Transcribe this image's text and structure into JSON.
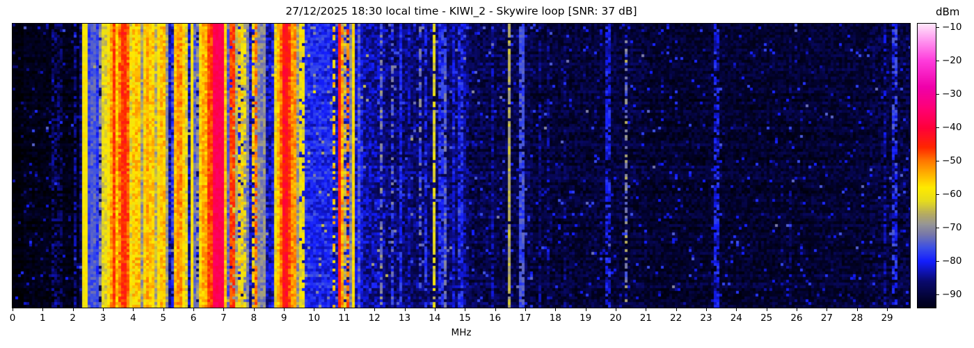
{
  "title": "27/12/2025 18:30 local time - KIWI_2 - Skywire loop [SNR: 37 dB]",
  "x_axis": {
    "unit_label": "MHz",
    "tick_labels": [
      "0",
      "1",
      "2",
      "3",
      "4",
      "5",
      "6",
      "7",
      "8",
      "9",
      "10",
      "11",
      "12",
      "13",
      "14",
      "15",
      "16",
      "17",
      "18",
      "19",
      "20",
      "21",
      "22",
      "23",
      "24",
      "25",
      "26",
      "27",
      "28",
      "29"
    ],
    "tick_values": [
      0,
      1,
      2,
      3,
      4,
      5,
      6,
      7,
      8,
      9,
      10,
      11,
      12,
      13,
      14,
      15,
      16,
      17,
      18,
      19,
      20,
      21,
      22,
      23,
      24,
      25,
      26,
      27,
      28,
      29
    ]
  },
  "colorbar": {
    "unit_label": "dBm",
    "tick_labels": [
      "−10",
      "−20",
      "−30",
      "−40",
      "−50",
      "−60",
      "−70",
      "−80",
      "−90"
    ],
    "tick_values": [
      -10,
      -20,
      -30,
      -40,
      -50,
      -60,
      -70,
      -80,
      -90
    ],
    "vmax": -9,
    "vmin": -94
  },
  "chart_data": {
    "type": "heatmap",
    "title": "27/12/2025 18:30 local time - KIWI_2 - Skywire loop [SNR: 37 dB]",
    "xlabel": "MHz",
    "colorbar_label": "dBm",
    "x_range_mhz": [
      0,
      29.76
    ],
    "value_range_dbm": [
      -94,
      -9
    ],
    "legend_position": "right-colorbar",
    "grid": false,
    "palette_stops_dbm_rgb": [
      [
        -97,
        0,
        0,
        0
      ],
      [
        -92,
        2,
        2,
        40
      ],
      [
        -86,
        10,
        10,
        110
      ],
      [
        -80,
        20,
        30,
        255
      ],
      [
        -76,
        60,
        80,
        230
      ],
      [
        -72,
        120,
        120,
        170
      ],
      [
        -69,
        150,
        150,
        150
      ],
      [
        -66,
        180,
        170,
        100
      ],
      [
        -62,
        230,
        220,
        30
      ],
      [
        -58,
        255,
        235,
        0
      ],
      [
        -54,
        255,
        180,
        0
      ],
      [
        -50,
        255,
        120,
        0
      ],
      [
        -46,
        255,
        40,
        0
      ],
      [
        -40,
        255,
        0,
        60
      ],
      [
        -34,
        255,
        0,
        120
      ],
      [
        -28,
        240,
        0,
        170
      ],
      [
        -20,
        255,
        60,
        220
      ],
      [
        -14,
        255,
        150,
        240
      ],
      [
        -9,
        255,
        230,
        250
      ]
    ],
    "noise_floor_fields": [
      "f_from_mhz",
      "f_to_mhz",
      "level_dbm",
      "variance_db"
    ],
    "noise_floor_regions": [
      [
        0,
        0.35,
        -95.5,
        1.5
      ],
      [
        0.35,
        2.25,
        -94,
        2.5
      ],
      [
        2.25,
        3.0,
        -87,
        4
      ],
      [
        3.0,
        5.2,
        -80,
        5
      ],
      [
        5.2,
        6.7,
        -84,
        4
      ],
      [
        6.7,
        7.6,
        -82,
        4
      ],
      [
        7.6,
        8.6,
        -83,
        4
      ],
      [
        8.6,
        9.65,
        -81,
        4
      ],
      [
        9.65,
        10.6,
        -79.5,
        3.5
      ],
      [
        10.6,
        11.65,
        -82,
        4
      ],
      [
        11.65,
        12.4,
        -84,
        4
      ],
      [
        12.4,
        15.1,
        -86.5,
        4
      ],
      [
        15.1,
        17.3,
        -89,
        4
      ],
      [
        17.3,
        21,
        -90.5,
        3.5
      ],
      [
        21,
        26.5,
        -91.5,
        3
      ],
      [
        26.5,
        28.4,
        -91,
        3
      ],
      [
        28.4,
        29.8,
        -90,
        4
      ]
    ],
    "stripe_fields": [
      "freq_mhz",
      "halfwidth_mhz",
      "level_dbm",
      "variance_db",
      "dash_gap_fraction"
    ],
    "signal_stripes": [
      [
        1.4,
        0.02,
        -86,
        3,
        0.5
      ],
      [
        1.55,
        0.02,
        -87,
        3,
        0.5
      ],
      [
        2.1,
        0.02,
        -85,
        3,
        0.4
      ],
      [
        2.42,
        0.025,
        -59,
        2.5,
        0
      ],
      [
        2.56,
        0.03,
        -77,
        3,
        0
      ],
      [
        2.68,
        0.025,
        -75,
        3,
        0
      ],
      [
        2.8,
        0.02,
        -78,
        3,
        0
      ],
      [
        2.93,
        0.02,
        -71,
        4,
        0.2
      ],
      [
        3.03,
        0.03,
        -62,
        4,
        0
      ],
      [
        3.12,
        0.02,
        -72,
        4,
        0
      ],
      [
        3.2,
        0.03,
        -58,
        4,
        0
      ],
      [
        3.28,
        0.03,
        -53,
        4,
        0
      ],
      [
        3.36,
        0.035,
        -47,
        3,
        0
      ],
      [
        3.44,
        0.02,
        -55,
        4,
        0
      ],
      [
        3.52,
        0.02,
        -63,
        5,
        0
      ],
      [
        3.6,
        0.03,
        -50,
        4,
        0
      ],
      [
        3.68,
        0.035,
        -46,
        3,
        0
      ],
      [
        3.76,
        0.03,
        -49,
        4,
        0
      ],
      [
        3.84,
        0.025,
        -56,
        4,
        0
      ],
      [
        3.92,
        0.02,
        -61,
        5,
        0
      ],
      [
        4.0,
        0.03,
        -57,
        5,
        0
      ],
      [
        4.08,
        0.025,
        -63,
        5,
        0
      ],
      [
        4.16,
        0.03,
        -56,
        5,
        0
      ],
      [
        4.24,
        0.02,
        -68,
        5,
        0
      ],
      [
        4.32,
        0.03,
        -74,
        4,
        0
      ],
      [
        4.4,
        0.03,
        -57,
        4,
        0
      ],
      [
        4.48,
        0.035,
        -54,
        4,
        0
      ],
      [
        4.56,
        0.025,
        -59,
        4,
        0
      ],
      [
        4.64,
        0.03,
        -56,
        4,
        0
      ],
      [
        4.72,
        0.02,
        -66,
        5,
        0
      ],
      [
        4.8,
        0.02,
        -73,
        4,
        0
      ],
      [
        4.88,
        0.03,
        -58,
        4,
        0
      ],
      [
        4.96,
        0.03,
        -55,
        4,
        0
      ],
      [
        5.06,
        0.025,
        -68,
        5,
        0
      ],
      [
        5.14,
        0.02,
        -74,
        4,
        0
      ],
      [
        5.28,
        0.02,
        -77,
        4,
        0.3
      ],
      [
        5.45,
        0.03,
        -55,
        4,
        0
      ],
      [
        5.53,
        0.03,
        -52,
        4,
        0
      ],
      [
        5.62,
        0.025,
        -57,
        4,
        0
      ],
      [
        5.7,
        0.02,
        -70,
        5,
        0
      ],
      [
        5.78,
        0.02,
        -62,
        5,
        0
      ],
      [
        5.95,
        0.02,
        -59,
        3,
        0
      ],
      [
        6.07,
        0.02,
        -74,
        4,
        0
      ],
      [
        6.17,
        0.02,
        -70,
        5,
        0.2
      ],
      [
        6.3,
        0.03,
        -57,
        4,
        0
      ],
      [
        6.38,
        0.025,
        -54,
        4,
        0
      ],
      [
        6.46,
        0.02,
        -61,
        5,
        0
      ],
      [
        6.56,
        0.015,
        -47,
        3,
        0
      ],
      [
        6.63,
        0.02,
        -57,
        4,
        0
      ],
      [
        6.85,
        0.16,
        -37.5,
        1.8,
        0
      ],
      [
        7.04,
        0.02,
        -55,
        3,
        0
      ],
      [
        7.13,
        0.02,
        -74,
        4,
        0
      ],
      [
        7.3,
        0.012,
        -47,
        3,
        0.1
      ],
      [
        7.4,
        0.02,
        -67,
        5,
        0
      ],
      [
        7.56,
        0.02,
        -59,
        6,
        0.3
      ],
      [
        7.66,
        0.02,
        -63,
        6,
        0.2
      ],
      [
        7.76,
        0.02,
        -72,
        5,
        0
      ],
      [
        7.97,
        0.02,
        -57,
        6,
        0.3
      ],
      [
        8.06,
        0.012,
        -50,
        4,
        0.2
      ],
      [
        8.14,
        0.02,
        -70,
        4,
        0
      ],
      [
        8.27,
        0.015,
        -71,
        4,
        0
      ],
      [
        8.37,
        0.015,
        -70,
        4,
        0
      ],
      [
        8.72,
        0.025,
        -60,
        5,
        0
      ],
      [
        8.8,
        0.03,
        -55,
        4,
        0
      ],
      [
        8.88,
        0.025,
        -57,
        4,
        0
      ],
      [
        8.96,
        0.03,
        -50,
        4,
        0
      ],
      [
        9.04,
        0.035,
        -43,
        3,
        0
      ],
      [
        9.12,
        0.03,
        -47,
        4,
        0
      ],
      [
        9.2,
        0.025,
        -54,
        4,
        0
      ],
      [
        9.3,
        0.025,
        -52,
        4,
        0
      ],
      [
        9.38,
        0.02,
        -57,
        5,
        0
      ],
      [
        9.46,
        0.02,
        -68,
        5,
        0
      ],
      [
        9.6,
        0.015,
        -60,
        4,
        0.2
      ],
      [
        10.67,
        0.02,
        -57,
        5,
        0.45
      ],
      [
        10.83,
        0.015,
        -44,
        3,
        0
      ],
      [
        10.89,
        0.015,
        -53,
        4,
        0.1
      ],
      [
        10.96,
        0.012,
        -70,
        4,
        0
      ],
      [
        11.05,
        0.015,
        -66,
        5,
        0.2
      ],
      [
        11.12,
        0.012,
        -50,
        4,
        0.35
      ],
      [
        11.21,
        0.015,
        -71,
        4,
        0
      ],
      [
        11.31,
        0.022,
        -57,
        2,
        0
      ],
      [
        11.47,
        0.015,
        -76,
        4,
        0
      ],
      [
        12.25,
        0.015,
        -72,
        5,
        0.45
      ],
      [
        12.6,
        0.015,
        -76,
        6,
        0.4
      ],
      [
        12.85,
        0.015,
        -80,
        4,
        0.2
      ],
      [
        13.12,
        0.012,
        -83,
        4,
        0.3
      ],
      [
        13.55,
        0.015,
        -74,
        6,
        0.5
      ],
      [
        13.7,
        0.015,
        -80,
        4,
        0.3
      ],
      [
        14.0,
        0.018,
        -62,
        4,
        0.15
      ],
      [
        14.22,
        0.015,
        -79,
        4,
        0.2
      ],
      [
        14.37,
        0.015,
        -74,
        4,
        0.2
      ],
      [
        14.62,
        0.015,
        -82,
        4,
        0.2
      ],
      [
        14.85,
        0.015,
        -80,
        4,
        0.25
      ],
      [
        15.02,
        0.015,
        -84,
        4,
        0.3
      ],
      [
        15.92,
        0.015,
        -85,
        4,
        0.3
      ],
      [
        16.45,
        0.012,
        -66,
        3,
        0.08
      ],
      [
        16.9,
        0.012,
        -76,
        3,
        0.15
      ],
      [
        17.5,
        0.012,
        -86,
        4,
        0.4
      ],
      [
        17.75,
        0.015,
        -86,
        4,
        0.35
      ],
      [
        18.3,
        0.015,
        -87,
        4,
        0.4
      ],
      [
        19.75,
        0.015,
        -81,
        4,
        0.35
      ],
      [
        20.32,
        0.013,
        -71,
        6,
        0.55
      ],
      [
        23.36,
        0.015,
        -81,
        4,
        0.3
      ],
      [
        25.8,
        0.015,
        -88,
        4,
        0.5
      ],
      [
        28.92,
        0.015,
        -84,
        4,
        0.45
      ],
      [
        29.25,
        0.018,
        -79,
        5,
        0.35
      ]
    ]
  }
}
